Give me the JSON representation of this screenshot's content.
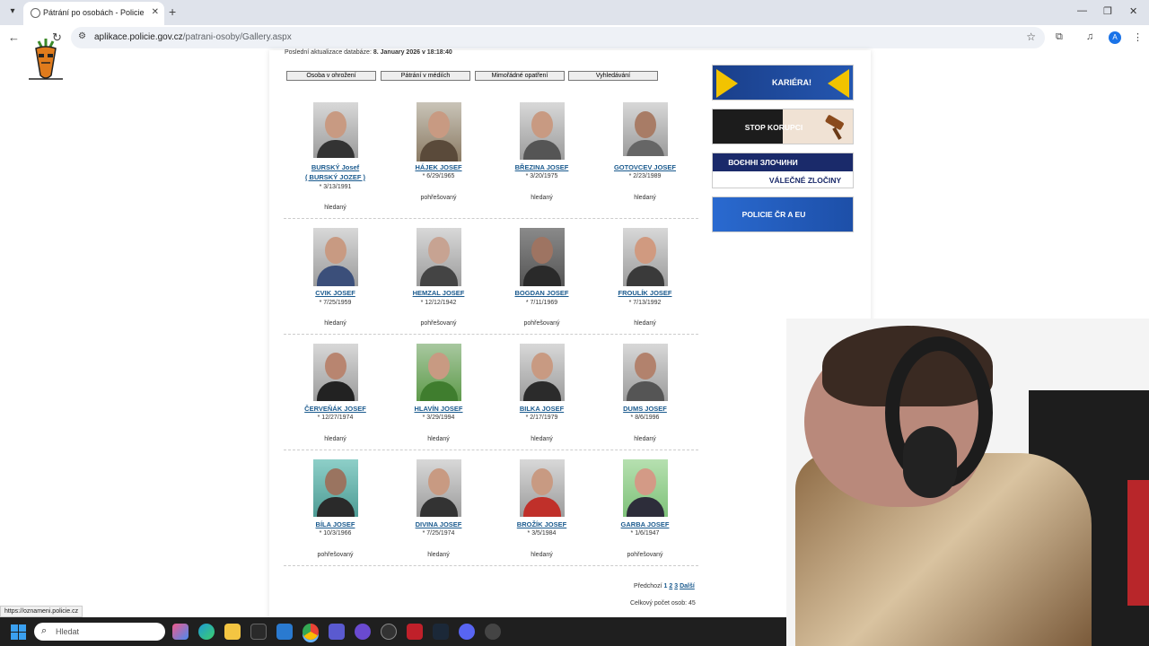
{
  "browser": {
    "tab_title": "Pátrání po osobách - Policie Če",
    "url_host": "aplikace.policie.gov.cz",
    "url_path": "/patrani-osoby/Gallery.aspx",
    "profile_initial": "A"
  },
  "page": {
    "updated_label": "Poslední aktualizace databáze:",
    "updated_value": "8. January 2026 v 18:18:40",
    "nav_buttons": [
      "Osoba v ohrožení",
      "Pátrání v médiích",
      "Mimořádné opatření",
      "Vyhledávání"
    ],
    "people": [
      {
        "name": "BURSKÝ Josef",
        "alias": "( BURSKÝ JOZEF )",
        "dob": "* 3/13/1991",
        "status": "hledaný"
      },
      {
        "name": "HÁJEK JOSEF",
        "dob": "* 6/29/1965",
        "status": "pohřešovaný"
      },
      {
        "name": "BŘEZINA JOSEF",
        "dob": "* 3/20/1975",
        "status": "hledaný"
      },
      {
        "name": "GOTOVCEV JOSEF",
        "dob": "* 2/23/1989",
        "status": "hledaný"
      },
      {
        "name": "CVIK JOSEF",
        "dob": "* 7/25/1959",
        "status": "hledaný"
      },
      {
        "name": "HEMZAL JOSEF",
        "dob": "* 12/12/1942",
        "status": "pohřešovaný"
      },
      {
        "name": "BOGDAN JOSEF",
        "dob": "* 7/11/1969",
        "status": "pohřešovaný"
      },
      {
        "name": "FROULÍK JOSEF",
        "dob": "* 7/13/1992",
        "status": "hledaný"
      },
      {
        "name": "ČERVEŇÁK JOSEF",
        "dob": "* 12/27/1974",
        "status": "hledaný"
      },
      {
        "name": "HLAVÍN JOSEF",
        "dob": "* 3/29/1994",
        "status": "hledaný"
      },
      {
        "name": "BILKA JOSEF",
        "dob": "* 2/17/1979",
        "status": "hledaný"
      },
      {
        "name": "DUMS JOSEF",
        "dob": "* 8/6/1996",
        "status": "hledaný"
      },
      {
        "name": "BÍLA JOSEF",
        "dob": "* 10/3/1966",
        "status": "pohřešovaný"
      },
      {
        "name": "DIVINA JOSEF",
        "dob": "* 7/25/1974",
        "status": "hledaný"
      },
      {
        "name": "BROŽÍK JOSEF",
        "dob": "* 3/5/1984",
        "status": "hledaný"
      },
      {
        "name": "GARBA JOSEF",
        "dob": "* 1/6/1947",
        "status": "pohřešovaný"
      }
    ],
    "pager": {
      "prev": "Předchozí",
      "p1": "1",
      "p2": "2",
      "p3": "3",
      "next": "Další"
    },
    "total": "Celkový počet osob: 45"
  },
  "banners": {
    "kariera": "KARIÉRA!",
    "korupce": "STOP KORUPCI",
    "zlocin_ua": "ВОЄННІ ЗЛОЧИНИ",
    "zlocin_cz": "VÁLEČNÉ ZLOČINY",
    "eu": "POLICIE ČR A EU"
  },
  "status_link": "https://oznameni.policie.cz",
  "taskbar": {
    "search_placeholder": "Hledat"
  },
  "colors": {
    "link": "#1a5a8e",
    "banner_blue": "#1a4a9a",
    "taskbar": "#1f1f1f"
  }
}
